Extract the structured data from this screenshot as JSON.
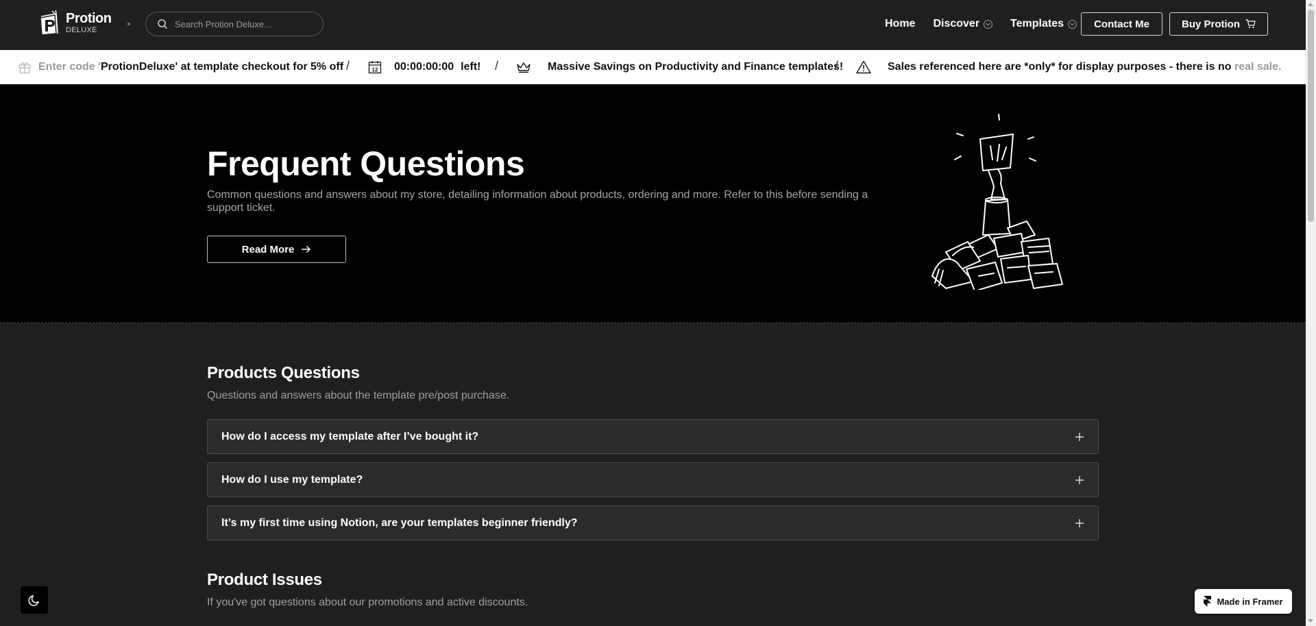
{
  "brand": {
    "name": "Protion",
    "sub": "DELUXE"
  },
  "search": {
    "placeholder": "Search Protion Deluxe..."
  },
  "nav": {
    "links": [
      {
        "label": "Home"
      },
      {
        "label": "Discover"
      },
      {
        "label": "Templates"
      }
    ],
    "contact_label": "Contact Me",
    "buy_label": "Buy Protion"
  },
  "promo": {
    "code_prefix": "Enter code '",
    "code": "ProtionDeluxe",
    "code_suffix": "' at template checkout for 5% off",
    "sep": "/",
    "calendar_day": "12",
    "countdown": "00:00:00:00",
    "countdown_suffix": "left!",
    "savings": "Massive Savings on Productivity and Finance templates!",
    "disclaimer_main": "Sales referenced here are *only* for display purposes - there is no",
    "disclaimer_tail": " real sale."
  },
  "hero": {
    "title": "Frequent Questions",
    "description": "Common questions and answers about my store, detailing information about products, ordering and more. Refer to this before sending a support ticket.",
    "read_more_label": "Read More"
  },
  "sections": [
    {
      "title": "Products Questions",
      "subtitle": "Questions and answers about the template pre/post purchase.",
      "faqs": [
        {
          "q": "How do I access my template after I’ve bought it?"
        },
        {
          "q": "How do I use my template?"
        },
        {
          "q": "It’s my first time using Notion, are your templates beginner friendly?"
        }
      ]
    },
    {
      "title": "Product Issues",
      "subtitle": "If you've got questions about our promotions and active discounts."
    }
  ],
  "framer_badge": "Made in Framer",
  "icons": {
    "search": "search-icon",
    "chevron": "chevron-down-icon",
    "cart": "cart-icon",
    "gift": "gift-icon",
    "calendar": "calendar-icon",
    "crown": "crown-icon",
    "warning": "warning-icon",
    "arrow": "arrow-right-icon",
    "plus": "plus-icon",
    "moon": "moon-icon",
    "framer": "framer-logo-icon"
  }
}
